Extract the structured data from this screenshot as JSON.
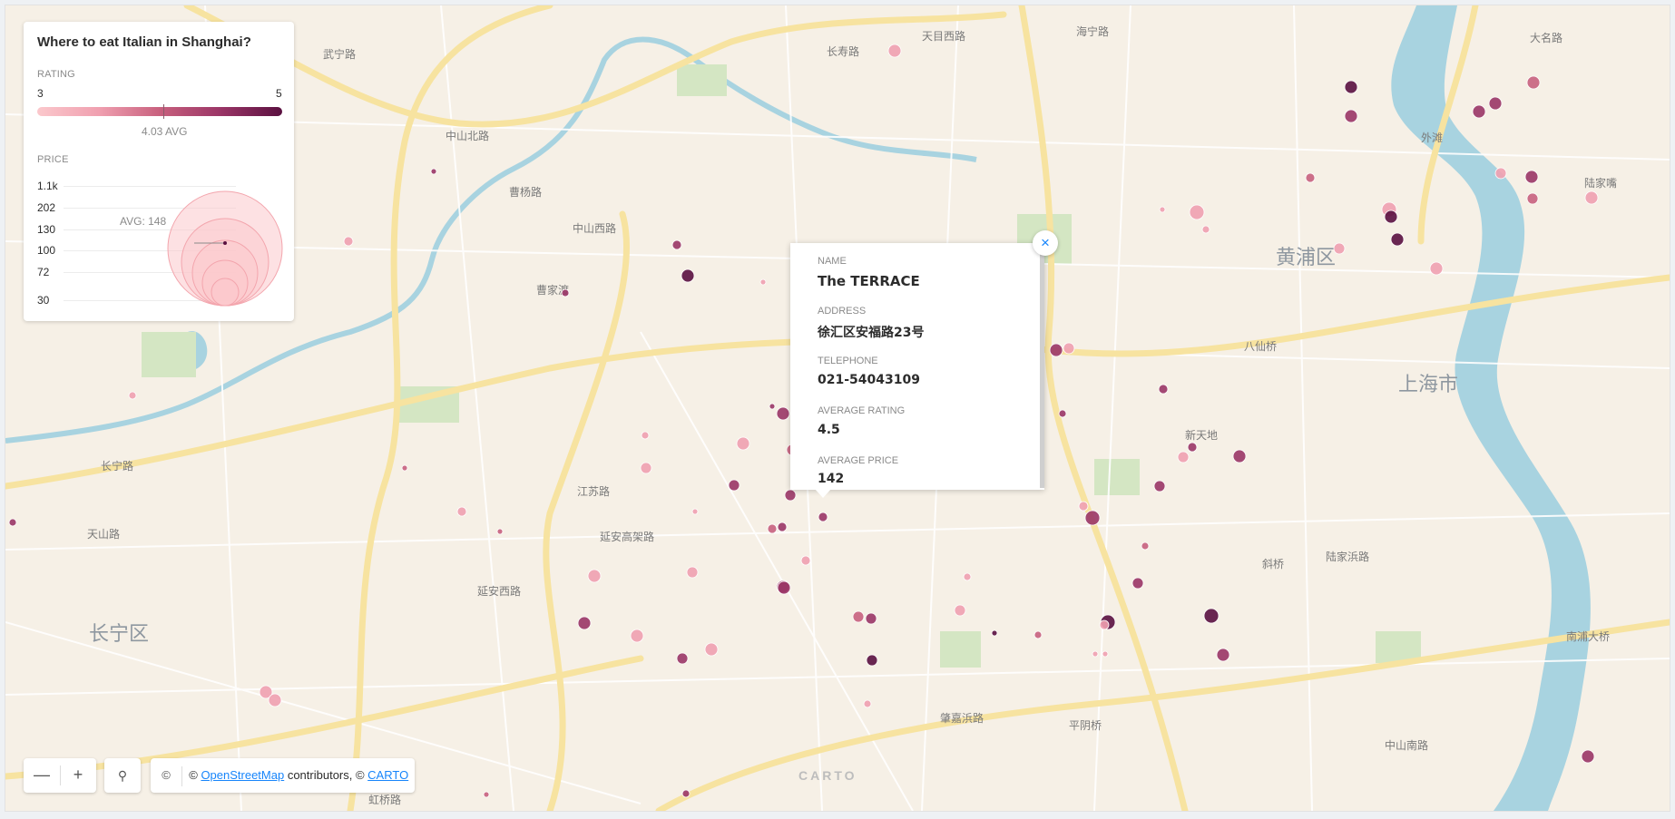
{
  "map": {
    "districts": [
      "黄浦区",
      "上海市",
      "长宁区"
    ],
    "street_labels": [
      "长寿路",
      "天目西路",
      "海宁路",
      "武宁路",
      "中山北路",
      "曹杨路",
      "中山西路",
      "曹家渡",
      "长宁路",
      "江苏路",
      "延安高架路",
      "延安西路",
      "天山路",
      "八仙桥",
      "新天地",
      "斜桥",
      "陆家浜路",
      "肇嘉浜路",
      "平阴桥",
      "大名路",
      "外滩",
      "陆家嘴",
      "南浦大桥",
      "中山南路",
      "虹桥路"
    ],
    "carto_logo": "CARTO"
  },
  "legend": {
    "title": "Where to eat Italian in Shanghai?",
    "rating": {
      "label": "RATING",
      "min": "3",
      "max": "5",
      "avg_label": "4.03 AVG",
      "avg_value": 4.03,
      "colors": [
        "#fbc8cc",
        "#f0a0b0",
        "#c8607e",
        "#9a3566",
        "#5a1040"
      ]
    },
    "price": {
      "label": "PRICE",
      "ticks": [
        "1.1k",
        "202",
        "130",
        "100",
        "72",
        "30"
      ],
      "avg_label": "AVG: 148"
    }
  },
  "popup": {
    "name_label": "NAME",
    "name": "The TERRACE",
    "address_label": "ADDRESS",
    "address": "徐汇区安福路23号",
    "telephone_label": "TELEPHONE",
    "telephone": "021-54043109",
    "rating_label": "AVERAGE RATING",
    "rating": "4.5",
    "price_label": "AVERAGE PRICE",
    "price": "142",
    "close_glyph": "×"
  },
  "controls": {
    "zoom_out": "—",
    "zoom_in": "+",
    "search_glyph": "⚲",
    "attribution_toggle": "©",
    "attr_prefix": "© ",
    "osm_link": "OpenStreetMap",
    "attr_middle": " contributors, © ",
    "carto_link": "CARTO"
  }
}
